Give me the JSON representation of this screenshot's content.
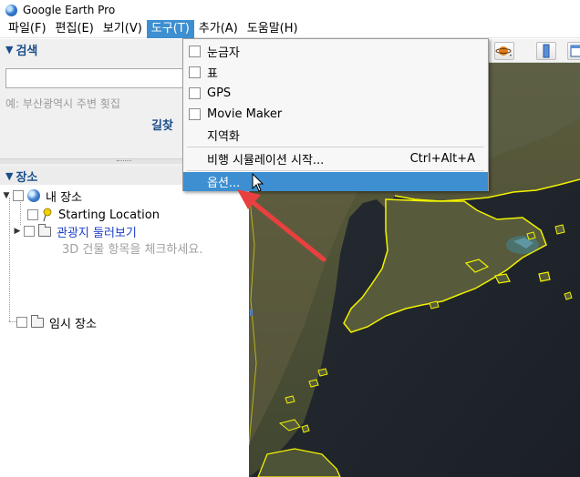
{
  "window": {
    "title": "Google Earth Pro"
  },
  "menubar": {
    "items": [
      {
        "label": "파일(F)",
        "name": "menu-file"
      },
      {
        "label": "편집(E)",
        "name": "menu-edit"
      },
      {
        "label": "보기(V)",
        "name": "menu-view"
      },
      {
        "label": "도구(T)",
        "name": "menu-tools"
      },
      {
        "label": "추가(A)",
        "name": "menu-add"
      },
      {
        "label": "도움말(H)",
        "name": "menu-help"
      }
    ],
    "open_index": 3
  },
  "search": {
    "header": "검색",
    "value": "",
    "hint": "예: 부산광역시 주변 횟집",
    "directions_label": "길찾"
  },
  "places": {
    "header": "장소",
    "my_places": "내 장소",
    "starting_location": "Starting Location",
    "tour_folder": "관광지 둘러보기",
    "tour_hint": "3D 건물 항목을 체크하세요.",
    "temporary_places": "임시 장소"
  },
  "tools_menu": {
    "items": [
      {
        "label": "눈금자",
        "checkbox": true
      },
      {
        "label": "표",
        "checkbox": true
      },
      {
        "label": "GPS",
        "checkbox": true
      },
      {
        "label": "Movie Maker",
        "checkbox": true
      },
      {
        "label": "지역화",
        "checkbox": false
      },
      {
        "label": "비행 시뮬레이션 시작...",
        "checkbox": false,
        "shortcut": "Ctrl+Alt+A"
      },
      {
        "label": "옵션...",
        "checkbox": false,
        "highlighted": true
      }
    ]
  },
  "toolbar": {
    "icons": [
      "planet-icon",
      "sidebar-icon",
      "window-icon"
    ]
  },
  "colors": {
    "menu_highlight": "#3d8fd1",
    "panel_header": "#1a4e8c",
    "coastline": "#f2f200",
    "annotation_arrow": "#e8403f"
  }
}
